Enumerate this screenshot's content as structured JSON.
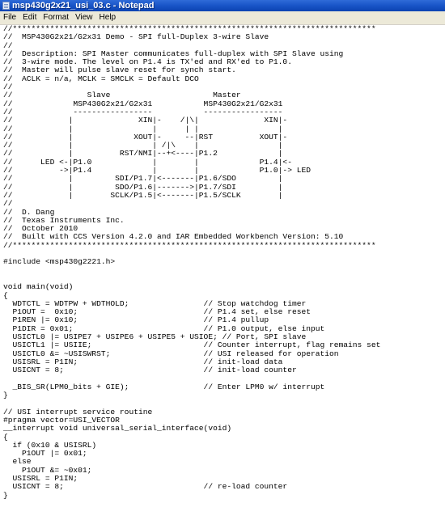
{
  "window": {
    "title": "msp430g2x21_usi_03.c - Notepad"
  },
  "menu": {
    "items": [
      "File",
      "Edit",
      "Format",
      "View",
      "Help"
    ]
  },
  "editor": {
    "lines": [
      "//******************************************************************************",
      "//  MSP430G2x21/G2x31 Demo - SPI full-Duplex 3-wire Slave",
      "//",
      "//  Description: SPI Master communicates full-duplex with SPI Slave using",
      "//  3-wire mode. The level on P1.4 is TX'ed and RX'ed to P1.0.",
      "//  Master will pulse slave reset for synch start.",
      "//  ACLK = n/a, MCLK = SMCLK = Default DCO",
      "//",
      "//                Slave                      Master",
      "//             MSP430G2x21/G2x31           MSP430G2x21/G2x31",
      "//             -----------------           -----------------",
      "//            |              XIN|-    /|\\|              XIN|-",
      "//            |                 |      | |                 |",
      "//            |             XOUT|-     --|RST          XOUT|-",
      "//            |                 | /|\\    |                 |",
      "//            |          RST/NMI|--+<----|P1.2             |",
      "//      LED <-|P1.0             |        |             P1.4|<-",
      "//          ->|P1.4             |        |             P1.0|-> LED",
      "//            |         SDI/P1.7|<-------|P1.6/SDO         |",
      "//            |         SDO/P1.6|------->|P1.7/SDI         |",
      "//            |        SCLK/P1.5|<-------|P1.5/SCLK        |",
      "//",
      "//  D. Dang",
      "//  Texas Instruments Inc.",
      "//  October 2010",
      "//  Built with CCS Version 4.2.0 and IAR Embedded Workbench Version: 5.10",
      "//******************************************************************************",
      "",
      "#include <msp430g2221.h>",
      "",
      "",
      "void main(void)",
      "{",
      "  WDTCTL = WDTPW + WDTHOLD;                // Stop watchdog timer",
      "  P1OUT =  0x10;                           // P1.4 set, else reset",
      "  P1REN |= 0x10;                           // P1.4 pullup",
      "  P1DIR = 0x01;                            // P1.0 output, else input",
      "  USICTL0 |= USIPE7 + USIPE6 + USIPE5 + USIOE; // Port, SPI slave",
      "  USICTL1 |= USIIE;                        // Counter interrupt, flag remains set",
      "  USICTL0 &= ~USISWRST;                    // USI released for operation",
      "  USISRL = P1IN;                           // init-load data",
      "  USICNT = 8;                              // init-load counter",
      "",
      "  _BIS_SR(LPM0_bits + GIE);                // Enter LPM0 w/ interrupt",
      "}",
      "",
      "// USI interrupt service routine",
      "#pragma vector=USI_VECTOR",
      "__interrupt void universal_serial_interface(void)",
      "{",
      "  if (0x10 & USISRL)",
      "    P1OUT |= 0x01;",
      "  else",
      "    P1OUT &= ~0x01;",
      "  USISRL = P1IN;",
      "  USICNT = 8;                              // re-load counter",
      "}"
    ]
  }
}
